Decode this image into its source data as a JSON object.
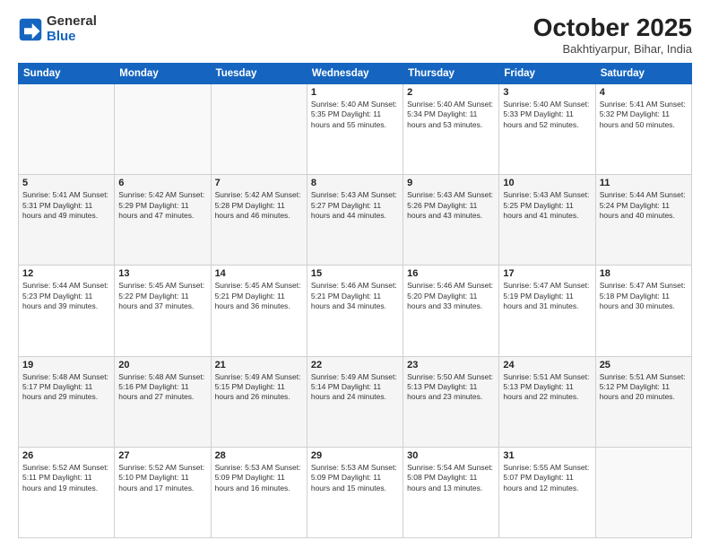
{
  "header": {
    "logo_line1": "General",
    "logo_line2": "Blue",
    "month": "October 2025",
    "location": "Bakhtiyarpur, Bihar, India"
  },
  "weekdays": [
    "Sunday",
    "Monday",
    "Tuesday",
    "Wednesday",
    "Thursday",
    "Friday",
    "Saturday"
  ],
  "weeks": [
    [
      {
        "day": "",
        "info": ""
      },
      {
        "day": "",
        "info": ""
      },
      {
        "day": "",
        "info": ""
      },
      {
        "day": "1",
        "info": "Sunrise: 5:40 AM\nSunset: 5:35 PM\nDaylight: 11 hours\nand 55 minutes."
      },
      {
        "day": "2",
        "info": "Sunrise: 5:40 AM\nSunset: 5:34 PM\nDaylight: 11 hours\nand 53 minutes."
      },
      {
        "day": "3",
        "info": "Sunrise: 5:40 AM\nSunset: 5:33 PM\nDaylight: 11 hours\nand 52 minutes."
      },
      {
        "day": "4",
        "info": "Sunrise: 5:41 AM\nSunset: 5:32 PM\nDaylight: 11 hours\nand 50 minutes."
      }
    ],
    [
      {
        "day": "5",
        "info": "Sunrise: 5:41 AM\nSunset: 5:31 PM\nDaylight: 11 hours\nand 49 minutes."
      },
      {
        "day": "6",
        "info": "Sunrise: 5:42 AM\nSunset: 5:29 PM\nDaylight: 11 hours\nand 47 minutes."
      },
      {
        "day": "7",
        "info": "Sunrise: 5:42 AM\nSunset: 5:28 PM\nDaylight: 11 hours\nand 46 minutes."
      },
      {
        "day": "8",
        "info": "Sunrise: 5:43 AM\nSunset: 5:27 PM\nDaylight: 11 hours\nand 44 minutes."
      },
      {
        "day": "9",
        "info": "Sunrise: 5:43 AM\nSunset: 5:26 PM\nDaylight: 11 hours\nand 43 minutes."
      },
      {
        "day": "10",
        "info": "Sunrise: 5:43 AM\nSunset: 5:25 PM\nDaylight: 11 hours\nand 41 minutes."
      },
      {
        "day": "11",
        "info": "Sunrise: 5:44 AM\nSunset: 5:24 PM\nDaylight: 11 hours\nand 40 minutes."
      }
    ],
    [
      {
        "day": "12",
        "info": "Sunrise: 5:44 AM\nSunset: 5:23 PM\nDaylight: 11 hours\nand 39 minutes."
      },
      {
        "day": "13",
        "info": "Sunrise: 5:45 AM\nSunset: 5:22 PM\nDaylight: 11 hours\nand 37 minutes."
      },
      {
        "day": "14",
        "info": "Sunrise: 5:45 AM\nSunset: 5:21 PM\nDaylight: 11 hours\nand 36 minutes."
      },
      {
        "day": "15",
        "info": "Sunrise: 5:46 AM\nSunset: 5:21 PM\nDaylight: 11 hours\nand 34 minutes."
      },
      {
        "day": "16",
        "info": "Sunrise: 5:46 AM\nSunset: 5:20 PM\nDaylight: 11 hours\nand 33 minutes."
      },
      {
        "day": "17",
        "info": "Sunrise: 5:47 AM\nSunset: 5:19 PM\nDaylight: 11 hours\nand 31 minutes."
      },
      {
        "day": "18",
        "info": "Sunrise: 5:47 AM\nSunset: 5:18 PM\nDaylight: 11 hours\nand 30 minutes."
      }
    ],
    [
      {
        "day": "19",
        "info": "Sunrise: 5:48 AM\nSunset: 5:17 PM\nDaylight: 11 hours\nand 29 minutes."
      },
      {
        "day": "20",
        "info": "Sunrise: 5:48 AM\nSunset: 5:16 PM\nDaylight: 11 hours\nand 27 minutes."
      },
      {
        "day": "21",
        "info": "Sunrise: 5:49 AM\nSunset: 5:15 PM\nDaylight: 11 hours\nand 26 minutes."
      },
      {
        "day": "22",
        "info": "Sunrise: 5:49 AM\nSunset: 5:14 PM\nDaylight: 11 hours\nand 24 minutes."
      },
      {
        "day": "23",
        "info": "Sunrise: 5:50 AM\nSunset: 5:13 PM\nDaylight: 11 hours\nand 23 minutes."
      },
      {
        "day": "24",
        "info": "Sunrise: 5:51 AM\nSunset: 5:13 PM\nDaylight: 11 hours\nand 22 minutes."
      },
      {
        "day": "25",
        "info": "Sunrise: 5:51 AM\nSunset: 5:12 PM\nDaylight: 11 hours\nand 20 minutes."
      }
    ],
    [
      {
        "day": "26",
        "info": "Sunrise: 5:52 AM\nSunset: 5:11 PM\nDaylight: 11 hours\nand 19 minutes."
      },
      {
        "day": "27",
        "info": "Sunrise: 5:52 AM\nSunset: 5:10 PM\nDaylight: 11 hours\nand 17 minutes."
      },
      {
        "day": "28",
        "info": "Sunrise: 5:53 AM\nSunset: 5:09 PM\nDaylight: 11 hours\nand 16 minutes."
      },
      {
        "day": "29",
        "info": "Sunrise: 5:53 AM\nSunset: 5:09 PM\nDaylight: 11 hours\nand 15 minutes."
      },
      {
        "day": "30",
        "info": "Sunrise: 5:54 AM\nSunset: 5:08 PM\nDaylight: 11 hours\nand 13 minutes."
      },
      {
        "day": "31",
        "info": "Sunrise: 5:55 AM\nSunset: 5:07 PM\nDaylight: 11 hours\nand 12 minutes."
      },
      {
        "day": "",
        "info": ""
      }
    ]
  ]
}
